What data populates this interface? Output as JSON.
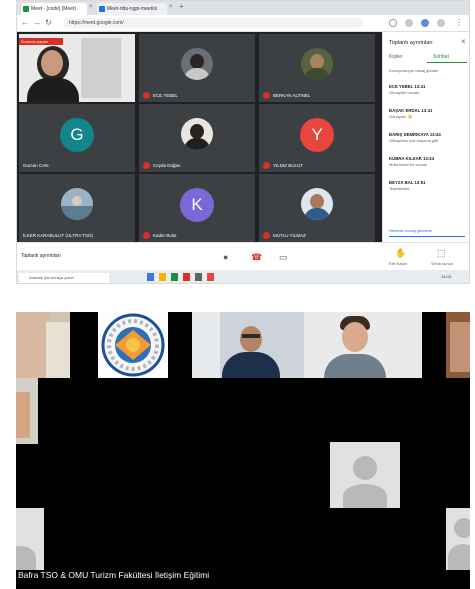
{
  "meet_screenshot": {
    "browser": {
      "tabs": [
        {
          "label": "Meet - [code] (Meet)"
        },
        {
          "label": "Meet-ridu-ngpi-meet/oi"
        }
      ],
      "url": "https://meet.google.com/",
      "new_tab": "+"
    },
    "participants": [
      {
        "name": "",
        "kind": "photo",
        "tile_label": "Sunumu yapan"
      },
      {
        "name": "ECE YEBEL",
        "kind": "photo"
      },
      {
        "name": "BERKAN ALTINEL",
        "kind": "photo"
      },
      {
        "name": "Gurcan CAN",
        "kind": "letter",
        "letter": "G",
        "color": "#12868a"
      },
      {
        "name": "Ceyda Doğan",
        "kind": "photo"
      },
      {
        "name": "YILDIZ BULUT",
        "kind": "letter",
        "letter": "Y",
        "color": "#e8453c"
      },
      {
        "name": "İLKER KARABULUT (ULTRA TSO)",
        "kind": "photo"
      },
      {
        "name": "Kader Bulut",
        "kind": "letter",
        "letter": "K",
        "color": "#7b68d8"
      },
      {
        "name": "MUTLU YILMAZ",
        "kind": "photo"
      }
    ],
    "side_panel": {
      "title": "Toplantı ayrıntıları",
      "tabs": [
        "Kişiler",
        "Sohbet"
      ],
      "chat_toggle": "Konuşmacıya mesaj gönder",
      "messages": [
        {
          "name": "ECE YEBEL  13:41",
          "text": "Günaydın hocam"
        },
        {
          "name": "BAŞAK ERDAL  13:41",
          "text": "Günaydın 👋"
        },
        {
          "name": "BARIŞ DEMİRKAYA  13:44",
          "text": "Gülüşünüz çok hoşuma gitti"
        },
        {
          "name": "KÜBRA KILDAR  13:44",
          "text": "Mükemmel bir sunum"
        },
        {
          "name": "BEYZA BAL  13:51",
          "text": "Teşekkürler"
        }
      ],
      "send_hint": "Herkese mesaj gönderin"
    },
    "controls": {
      "meeting_label": "Toplantı ayrıntıları",
      "mic_icon": "mic-icon",
      "hangup_icon": "hangup-icon",
      "camera_icon": "camera-icon",
      "raise_label": "Elle Kaldır",
      "present_label": "Şimdi sunun"
    },
    "taskbar": {
      "search_placeholder": "Aramak için buraya yazın",
      "time": "14:03"
    }
  },
  "zoom_screenshot": {
    "caption": "Bafra TSO & OMU Turizm Fakültesi İletişim Eğitimi"
  }
}
